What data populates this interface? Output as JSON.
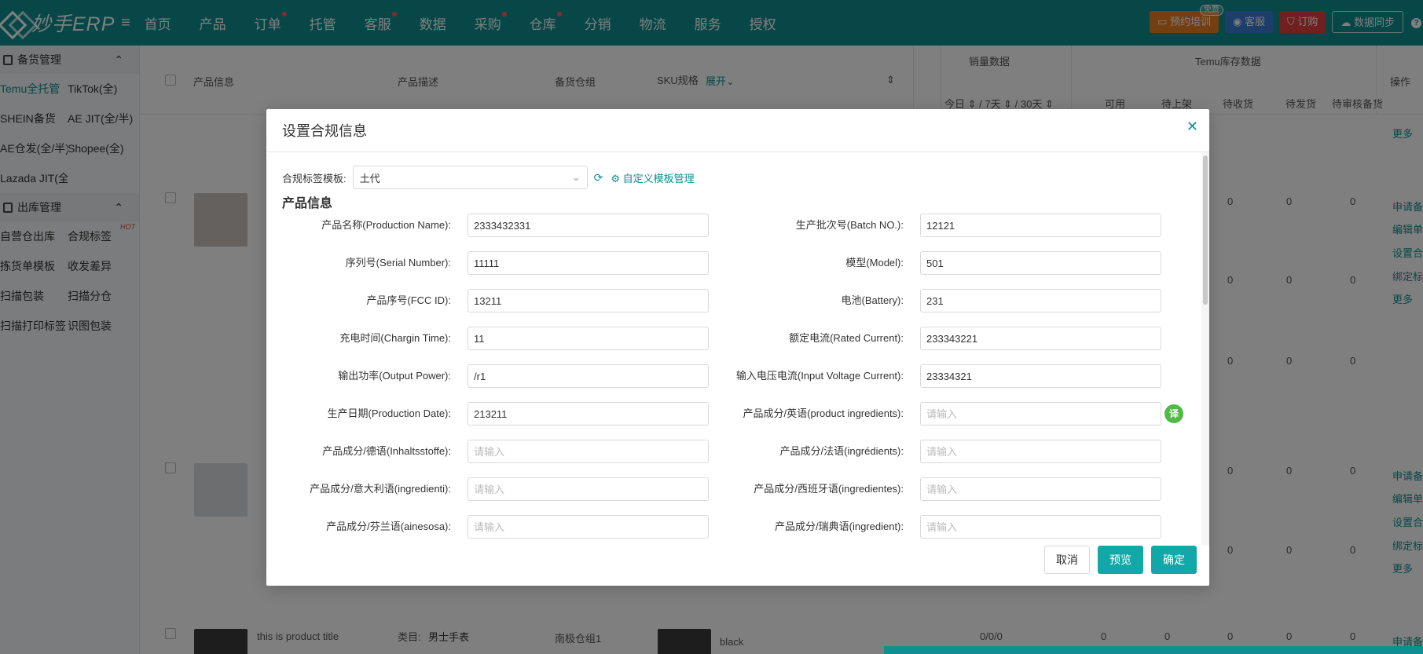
{
  "app": {
    "logo_text": "妙手ERP",
    "menu_icon": "hamburger-icon"
  },
  "nav": [
    {
      "label": "首页",
      "dot": false
    },
    {
      "label": "产品",
      "dot": false
    },
    {
      "label": "订单",
      "dot": true
    },
    {
      "label": "托管",
      "dot": false
    },
    {
      "label": "客服",
      "dot": true
    },
    {
      "label": "数据",
      "dot": false
    },
    {
      "label": "采购",
      "dot": true
    },
    {
      "label": "仓库",
      "dot": true
    },
    {
      "label": "分销",
      "dot": false
    },
    {
      "label": "物流",
      "dot": false
    },
    {
      "label": "服务",
      "dot": false
    },
    {
      "label": "授权",
      "dot": false
    }
  ],
  "top_actions": {
    "training": "预约培训",
    "training_badge": "免费",
    "service": "客服",
    "order": "订购",
    "sync": "数据同步",
    "help": "?"
  },
  "sidebar": {
    "group1": "备货管理",
    "group1_items": [
      "Temu全托管",
      "TikTok(全)",
      "SHEIN备货",
      "AE JIT(全/半)",
      "AE仓发(全/半)",
      "Shopee(全)",
      "Lazada JIT(全)"
    ],
    "group2": "出库管理",
    "group2_items": [
      "自营仓出库",
      "合规标签",
      "拣货单模板",
      "收发差异",
      "扫描包装",
      "扫描分仓",
      "扫描打印标签",
      "识图包装"
    ],
    "hot": "HOT"
  },
  "table": {
    "headers": {
      "product_info": "产品信息",
      "product_desc": "产品描述",
      "warehouse": "备货仓组",
      "sku": "SKU规格",
      "expand": "展开",
      "sales": "销量数据",
      "temu_stock": "Temu库存数据",
      "actions": "操作",
      "sales_sub": "今日 ⇕ / 7天 ⇕ / 30天 ⇕",
      "stock_sub": [
        "可用",
        "待上架",
        "待收货",
        "待发货",
        "待审核备货"
      ]
    },
    "row_bottom": {
      "title": "this is product title",
      "category_label": "类目:",
      "category": "男士手表",
      "warehouse": "南极仓组1",
      "sku": "black",
      "sales": "0/0/0",
      "stock": [
        "0",
        "0",
        "0",
        "0",
        "0"
      ],
      "action": "申请备"
    },
    "zeros": "0",
    "actions_col": [
      "更多",
      "申请备",
      "编辑单",
      "设置合",
      "绑定标",
      "更多"
    ]
  },
  "modal": {
    "title": "设置合规信息",
    "template_label": "合规标签模板:",
    "template_value": "土代",
    "template_manage": "自定义模板管理",
    "section": "产品信息",
    "fields": [
      {
        "left_label": "产品名称(Production Name):",
        "left_value": "2333432331",
        "right_label": "生产批次号(Batch NO.):",
        "right_value": "12121"
      },
      {
        "left_label": "序列号(Serial Number):",
        "left_value": "11111",
        "right_label": "模型(Model):",
        "right_value": "501"
      },
      {
        "left_label": "产品序号(FCC ID):",
        "left_value": "13211",
        "right_label": "电池(Battery):",
        "right_value": "231"
      },
      {
        "left_label": "充电时间(Chargin Time):",
        "left_value": "11",
        "right_label": "额定电流(Rated Current):",
        "right_value": "233343221"
      },
      {
        "left_label": "输出功率(Output Power):",
        "left_value": "/r1",
        "right_label": "输入电压电流(Input Voltage Current):",
        "right_value": "23334321"
      },
      {
        "left_label": "生产日期(Production Date):",
        "left_value": "213211",
        "right_label": "产品成分/英语(product ingredients):",
        "right_value": ""
      },
      {
        "left_label": "产品成分/德语(Inhaltsstoffe):",
        "left_value": "",
        "right_label": "产品成分/法语(ingrédients):",
        "right_value": ""
      },
      {
        "left_label": "产品成分/意大利语(ingredienti):",
        "left_value": "",
        "right_label": "产品成分/西班牙语(ingredientes):",
        "right_value": ""
      },
      {
        "left_label": "产品成分/芬兰语(ainesosa):",
        "left_value": "",
        "right_label": "产品成分/瑞典语(ingredient):",
        "right_value": ""
      }
    ],
    "placeholder": "请输入",
    "translate_label": "译",
    "buttons": {
      "cancel": "取消",
      "preview": "预览",
      "confirm": "确定"
    },
    "close_icon": "close-icon"
  },
  "colors": {
    "brand": "#0e8f90",
    "primary_button": "#13a8a8",
    "translate": "#52b847",
    "dot": "#ff5a5a"
  }
}
